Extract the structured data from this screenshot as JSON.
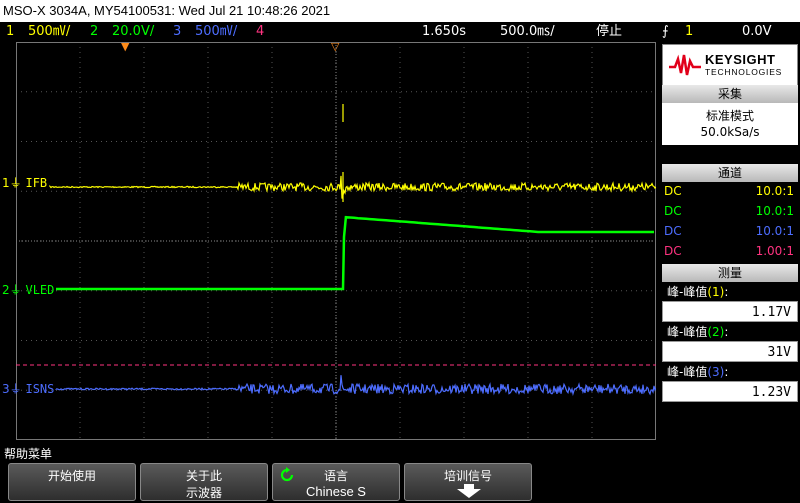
{
  "title_bar": "MSO-X 3034A, MY54100531: Wed Jul 21 10:48:26 2021",
  "status": {
    "ch1_num": "1",
    "ch1_scale": "500㎷/",
    "ch2_num": "2",
    "ch2_scale": "20.0V/",
    "ch3_num": "3",
    "ch3_scale": "500㎷/",
    "ch4_num": "4",
    "time_pos": "1.650s",
    "time_scale": "500.0㎳/",
    "run_state": "停止",
    "trig_icon": "⨍",
    "trig_ch": "1",
    "trig_level": "0.0V"
  },
  "logo": {
    "brand": "KEYSIGHT",
    "sub": "TECHNOLOGIES"
  },
  "acquire": {
    "header": "采集",
    "mode": "标准模式",
    "rate": "50.0kSa/s"
  },
  "channels": {
    "header": "通道",
    "rows": [
      {
        "coupling": "DC",
        "probe": "10.0:1",
        "color": "#ffff00"
      },
      {
        "coupling": "DC",
        "probe": "10.0:1",
        "color": "#00ff00"
      },
      {
        "coupling": "DC",
        "probe": "10.0:1",
        "color": "#4d6dff"
      },
      {
        "coupling": "DC",
        "probe": "1.00:1",
        "color": "#ff3380"
      }
    ]
  },
  "measure": {
    "header": "测量",
    "items": [
      {
        "label": "峰-峰值",
        "ch": "(1)",
        "ch_color": "#ffff00",
        "colon": ":",
        "value": "1.17V"
      },
      {
        "label": "峰-峰值",
        "ch": "(2)",
        "ch_color": "#00ff00",
        "colon": ":",
        "value": "31V"
      },
      {
        "label": "峰-峰值",
        "ch": "(3)",
        "ch_color": "#4d6dff",
        "colon": ":",
        "value": "1.23V"
      }
    ]
  },
  "traces": {
    "ch1": {
      "label": "IFB",
      "num": "1",
      "color": "#ffff00"
    },
    "ch2": {
      "label": "VLED",
      "num": "2",
      "color": "#00ff00"
    },
    "ch3": {
      "label": "ISNS",
      "num": "3",
      "color": "#4d6dff"
    },
    "trigger_level_color": "#ff3380"
  },
  "menu": {
    "title": "帮助菜单",
    "keys": [
      {
        "line1": "开始使用",
        "line2": ""
      },
      {
        "line1": "关于此",
        "line2": "示波器"
      },
      {
        "line1": "语言",
        "line2": "Chinese S"
      },
      {
        "line1": "培训信号",
        "line2": ""
      }
    ]
  },
  "colors": {
    "ch1": "#ffff00",
    "ch2": "#00ff00",
    "ch3": "#4d6dff",
    "ch4": "#ff3380",
    "marker": "#ff8c1a"
  }
}
